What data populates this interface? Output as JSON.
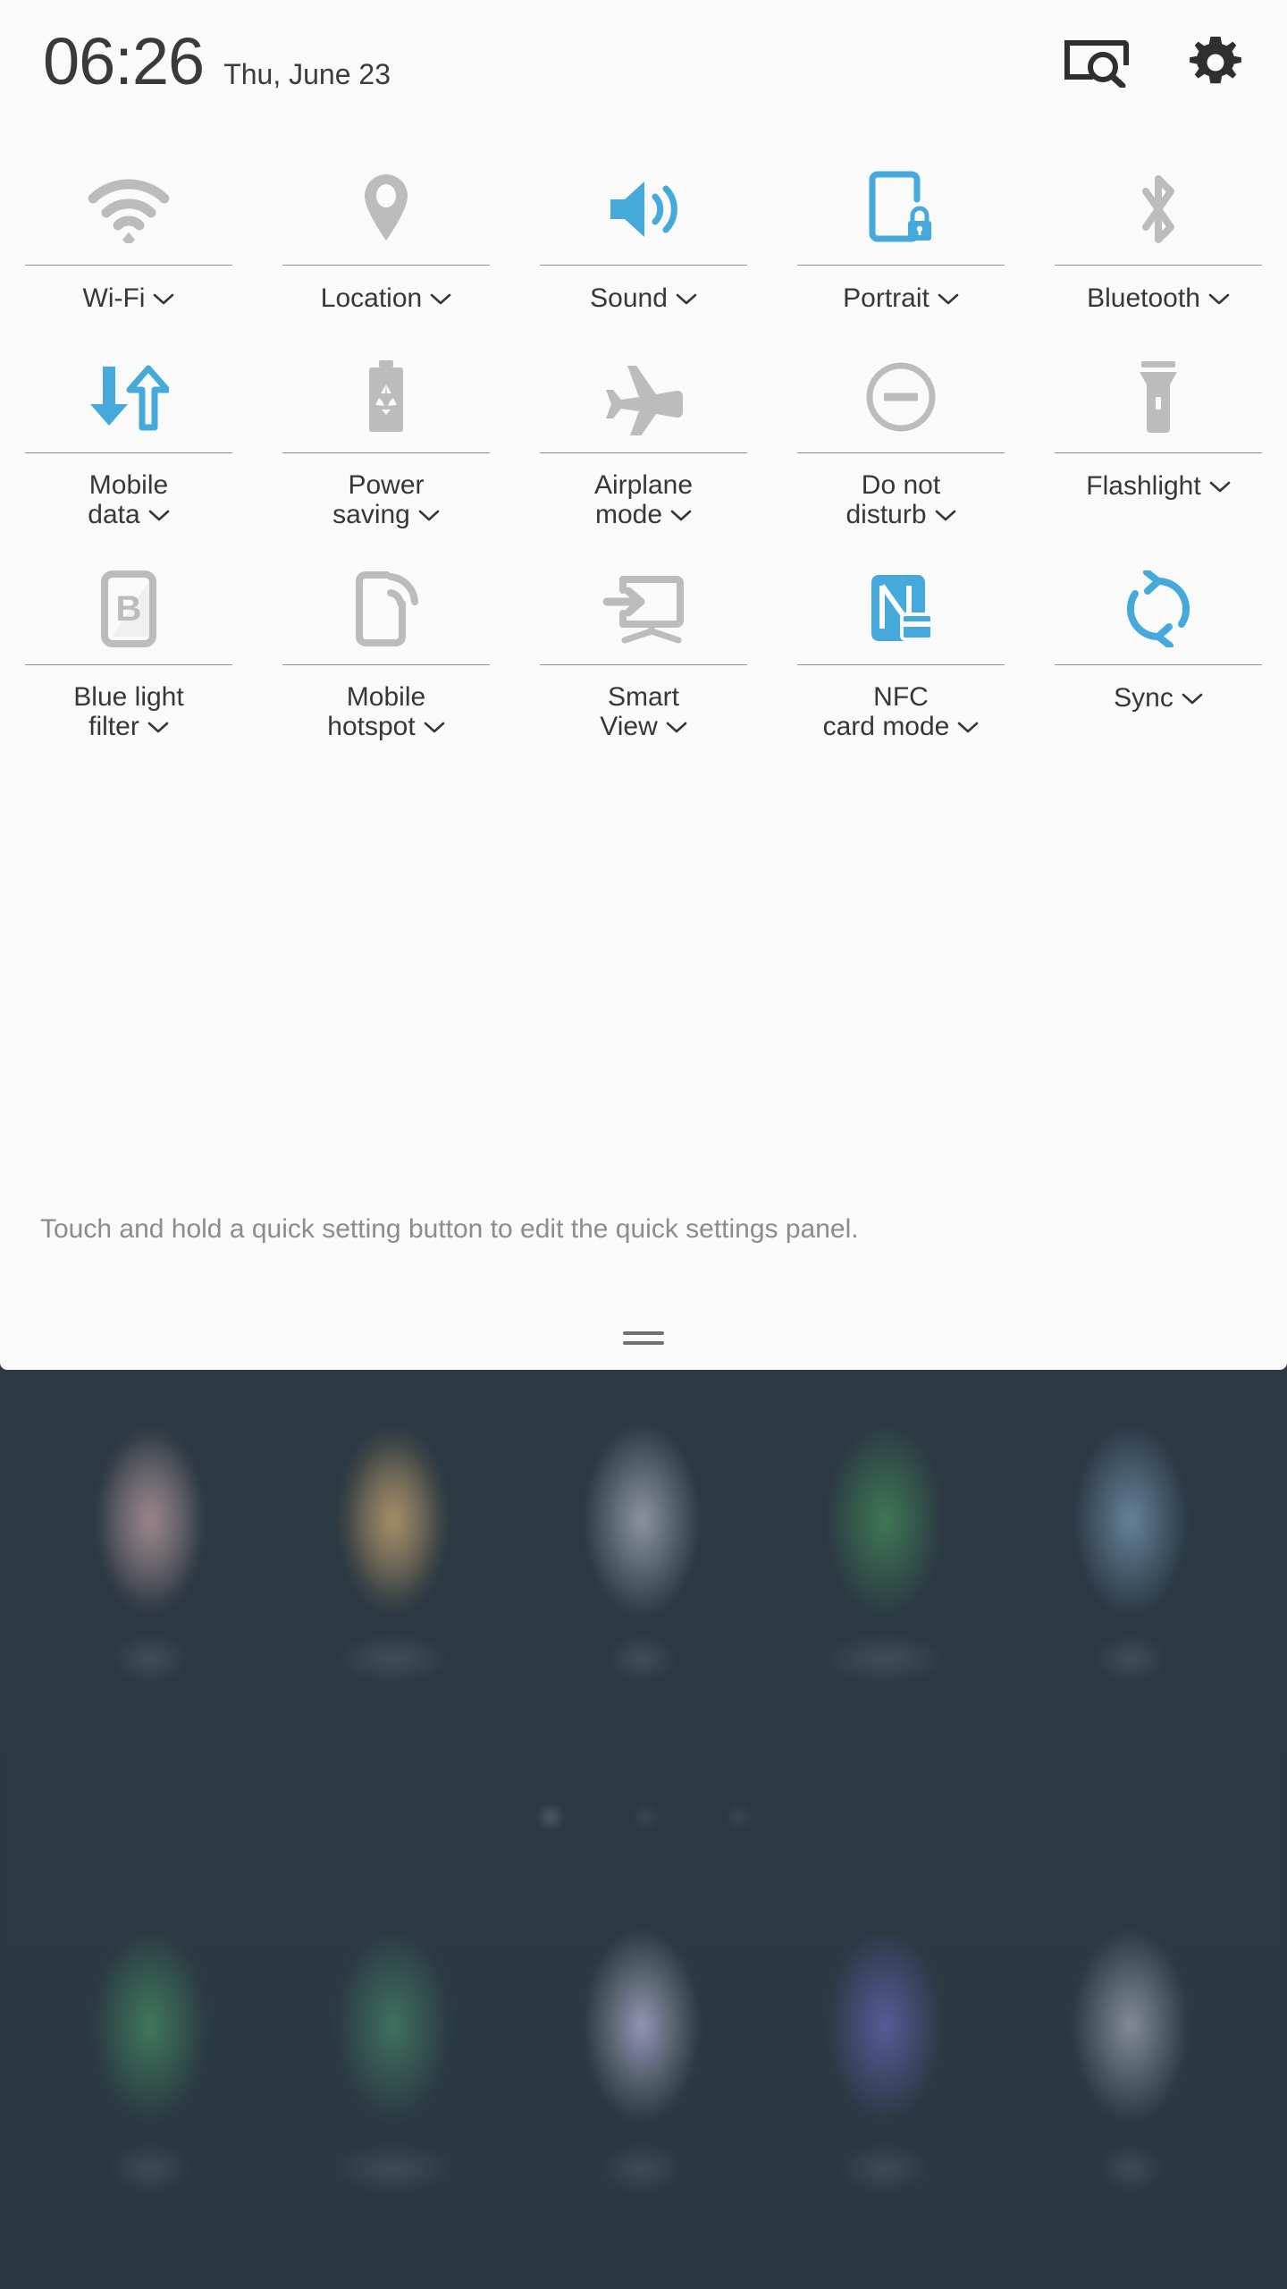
{
  "status_bar": {
    "time": "06:26",
    "date": "Thu, June 23",
    "finder_icon": "finder-search-icon",
    "settings_icon": "gear-icon"
  },
  "colors": {
    "accent_active": "#45a9db",
    "icon_inactive": "#bcbcbc",
    "panel_background": "#fafafa",
    "label_text": "#373737",
    "hint_text": "#8c8c8c",
    "divider": "#8d8d8d",
    "home_background": "#2c3a44"
  },
  "quick_settings": {
    "rows": [
      [
        {
          "label": "Wi-Fi",
          "icon": "wifi-icon",
          "active": false,
          "has_dropdown": true
        },
        {
          "label": "Location",
          "icon": "location-pin-icon",
          "active": false,
          "has_dropdown": true
        },
        {
          "label": "Sound",
          "icon": "sound-speaker-icon",
          "active": true,
          "has_dropdown": true
        },
        {
          "label": "Portrait",
          "icon": "screen-rotation-lock-icon",
          "active": true,
          "has_dropdown": true
        },
        {
          "label": "Bluetooth",
          "icon": "bluetooth-icon",
          "active": false,
          "has_dropdown": true
        }
      ],
      [
        {
          "label": "Mobile\ndata",
          "icon": "mobile-data-arrows-icon",
          "active": true,
          "has_dropdown": true
        },
        {
          "label": "Power\nsaving",
          "icon": "battery-recycle-icon",
          "active": false,
          "has_dropdown": true
        },
        {
          "label": "Airplane\nmode",
          "icon": "airplane-icon",
          "active": false,
          "has_dropdown": true
        },
        {
          "label": "Do not\ndisturb",
          "icon": "do-not-disturb-icon",
          "active": false,
          "has_dropdown": true
        },
        {
          "label": "Flashlight",
          "icon": "flashlight-icon",
          "active": false,
          "has_dropdown": true
        }
      ],
      [
        {
          "label": "Blue light\nfilter",
          "icon": "blue-light-filter-icon",
          "active": false,
          "has_dropdown": true
        },
        {
          "label": "Mobile\nhotspot",
          "icon": "mobile-hotspot-icon",
          "active": false,
          "has_dropdown": true
        },
        {
          "label": "Smart\nView",
          "icon": "smart-view-icon",
          "active": false,
          "has_dropdown": true
        },
        {
          "label": "NFC\ncard mode",
          "icon": "nfc-card-mode-icon",
          "active": true,
          "has_dropdown": true
        },
        {
          "label": "Sync",
          "icon": "sync-refresh-icon",
          "active": true,
          "has_dropdown": true
        }
      ]
    ],
    "hint": "Touch and hold a quick setting button to edit the quick settings panel.",
    "handle": "panel-drag-handle"
  },
  "home_screen": {
    "page_indicator": {
      "total": 3,
      "current": 1
    },
    "dock_row_count": 5
  }
}
